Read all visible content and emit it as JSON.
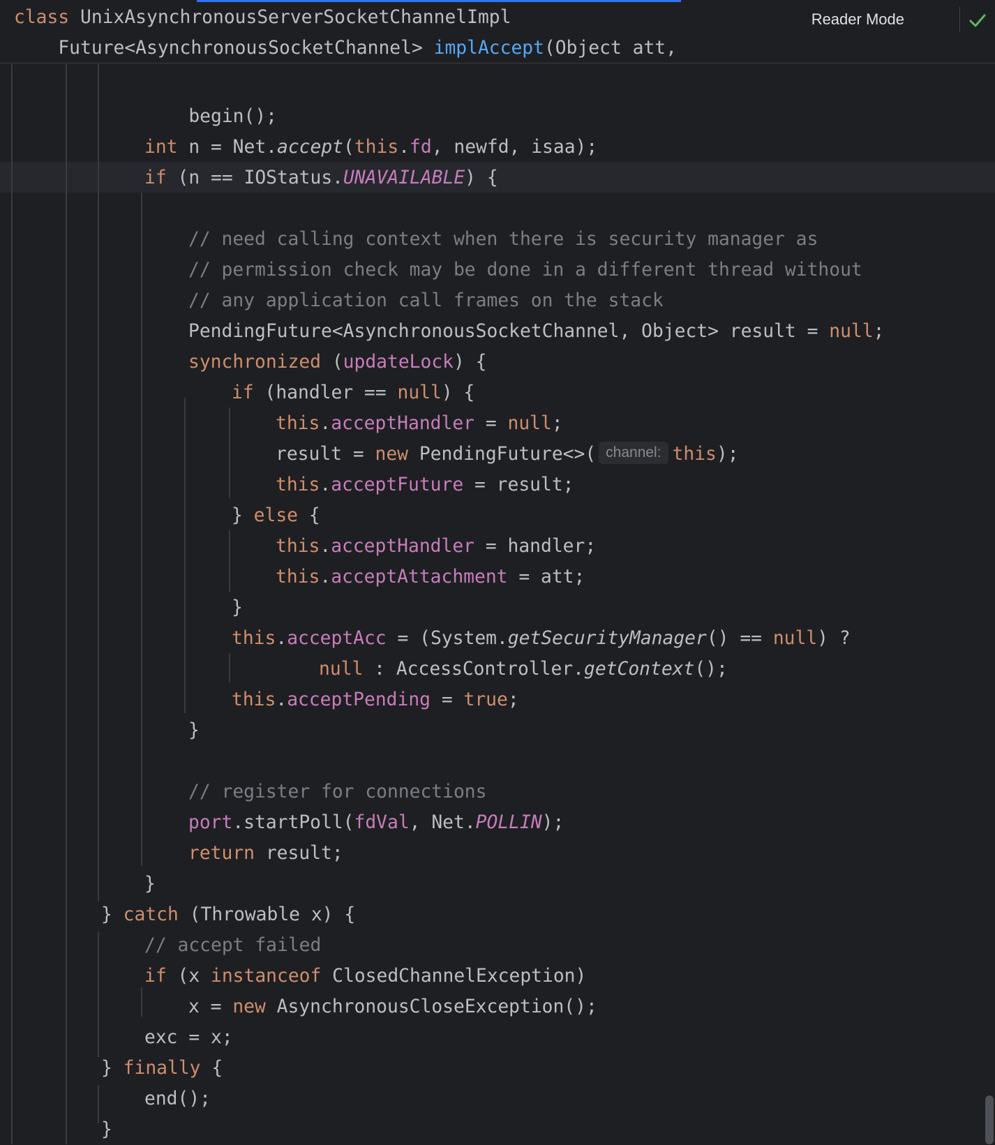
{
  "header": {
    "class_line": "class UnixAsynchronousServerSocketChannelImpl",
    "method_line": "    Future<AsynchronousSocketChannel> implAccept(Object att,",
    "reader_mode": "Reader Mode",
    "status_icon": "check-icon"
  },
  "colors": {
    "background": "#1e1f22",
    "keyword": "#cf8e6d",
    "field": "#c77dbb",
    "method_decl": "#56a8f5",
    "comment": "#7a7e85",
    "text": "#bcbec4",
    "progress": "#3574f0"
  },
  "code": {
    "l1": "begin();",
    "l3": "int n = Net.accept(this.fd, newfd, isaa);",
    "l4": "if (n == IOStatus.UNAVAILABLE) {",
    "c1": "// need calling context when there is security manager as",
    "c2": "// permission check may be done in a different thread without",
    "c3": "// any application call frames on the stack",
    "l9": "PendingFuture<AsynchronousSocketChannel, Object> result = null;",
    "l10": "synchronized (updateLock) {",
    "l11": "if (handler == null) {",
    "l12": "this.acceptHandler = null;",
    "l13a": "result = new PendingFuture<>(",
    "l13_hint": "channel:",
    "l13b": "this);",
    "l14": "this.acceptFuture = result;",
    "l15": "} else {",
    "l16": "this.acceptHandler = handler;",
    "l17": "this.acceptAttachment = att;",
    "l18": "}",
    "l19": "this.acceptAcc = (System.getSecurityManager() == null) ?",
    "l20": "null : AccessController.getContext();",
    "l21": "this.acceptPending = true;",
    "l22": "}",
    "c4": "// register for connections",
    "l25": "port.startPoll(fdVal, Net.POLLIN);",
    "l26": "return result;",
    "l27": "}",
    "l28": "} catch (Throwable x) {",
    "c5": "// accept failed",
    "l30": "if (x instanceof ClosedChannelException)",
    "l31": "x = new AsynchronousCloseException();",
    "l32": "exc = x;",
    "l33": "} finally {",
    "l34": "end();",
    "l35": "}"
  }
}
